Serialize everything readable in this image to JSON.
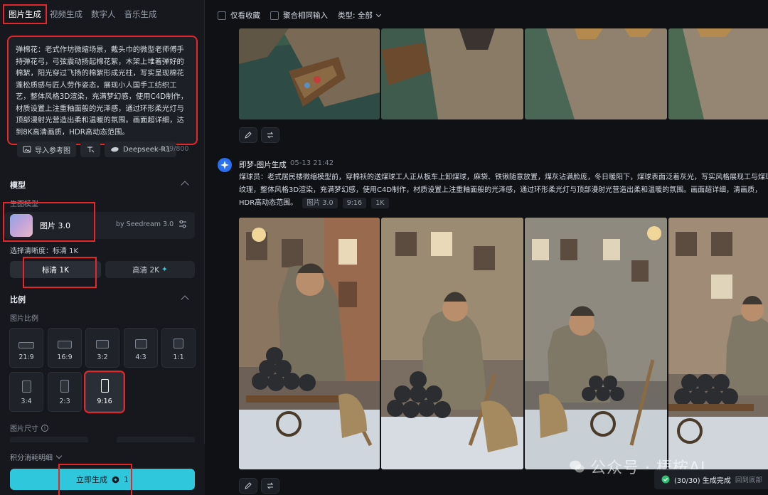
{
  "tabs": [
    "图片生成",
    "视频生成",
    "数字人",
    "音乐生成"
  ],
  "prompt": {
    "text": "弹棉花：老式作坊微缩场景，戴头巾的微型老师傅手持弹花弓，弓弦震动扬起棉花絮，木架上堆着弹好的棉絮，阳光穿过飞扬的棉絮形成光柱，写实呈现棉花蓬松质感与匠人劳作姿态，展现小人国手工纺织工艺，整体风格3D渲染，充满梦幻感，使用C4D制作，材质设置上注重釉面般的光泽感，通过环形柔光灯与顶部漫射光营造出柔和温暖的氛围。画面超详细，达到8K高清画质，HDR高动态范围。",
    "import_ref": "导入参考图",
    "model_chip": "Deepseek-R1",
    "counter": "179/800"
  },
  "model": {
    "section": "模型",
    "sub": "生图模型",
    "name": "图片 3.0",
    "by": "by Seedream 3.0",
    "clarity_label": "选择清晰度：标清 1K",
    "q1": "标清 1K",
    "q2": "高清 2K"
  },
  "ratio": {
    "section": "比例",
    "sub": "图片比例",
    "options": [
      "21:9",
      "16:9",
      "3:2",
      "4:3",
      "1:1",
      "3:4",
      "2:3",
      "9:16"
    ],
    "size_label": "图片尺寸"
  },
  "credits": "积分消耗明细",
  "generate": {
    "label": "立即生成",
    "cost": "1"
  },
  "filters": {
    "favorites": "仅看收藏",
    "merge": "聚合相同输入",
    "type": "类型: 全部"
  },
  "post": {
    "title": "即梦-图片生成",
    "time": "05-13   21:42",
    "desc": "煤球员：老式居民楼微缩模型前，穿棉袄的送煤球工人正从板车上卸煤球，麻袋、铁锹随意放置，煤灰沾满脸庞，冬日暖阳下，煤球表面泛着灰光，写实风格展现工与煤球纹理，整体风格3D渲染，充满梦幻感，使用C4D制作，材质设置上注重釉面般的光泽感，通过环形柔光灯与顶部漫射光营造出柔和温暖的氛围。画面超详细，清画质，HDR高动态范围。",
    "tags": [
      "图片 3.0",
      "9:16",
      "1K"
    ]
  },
  "toast": {
    "text": "(30/30) 生成完成",
    "sub": "回到底部"
  },
  "watermark": "公众号 · 梧桉AI",
  "colors": {
    "accent": "#2ec7dc",
    "highlight": "#e5262b"
  }
}
